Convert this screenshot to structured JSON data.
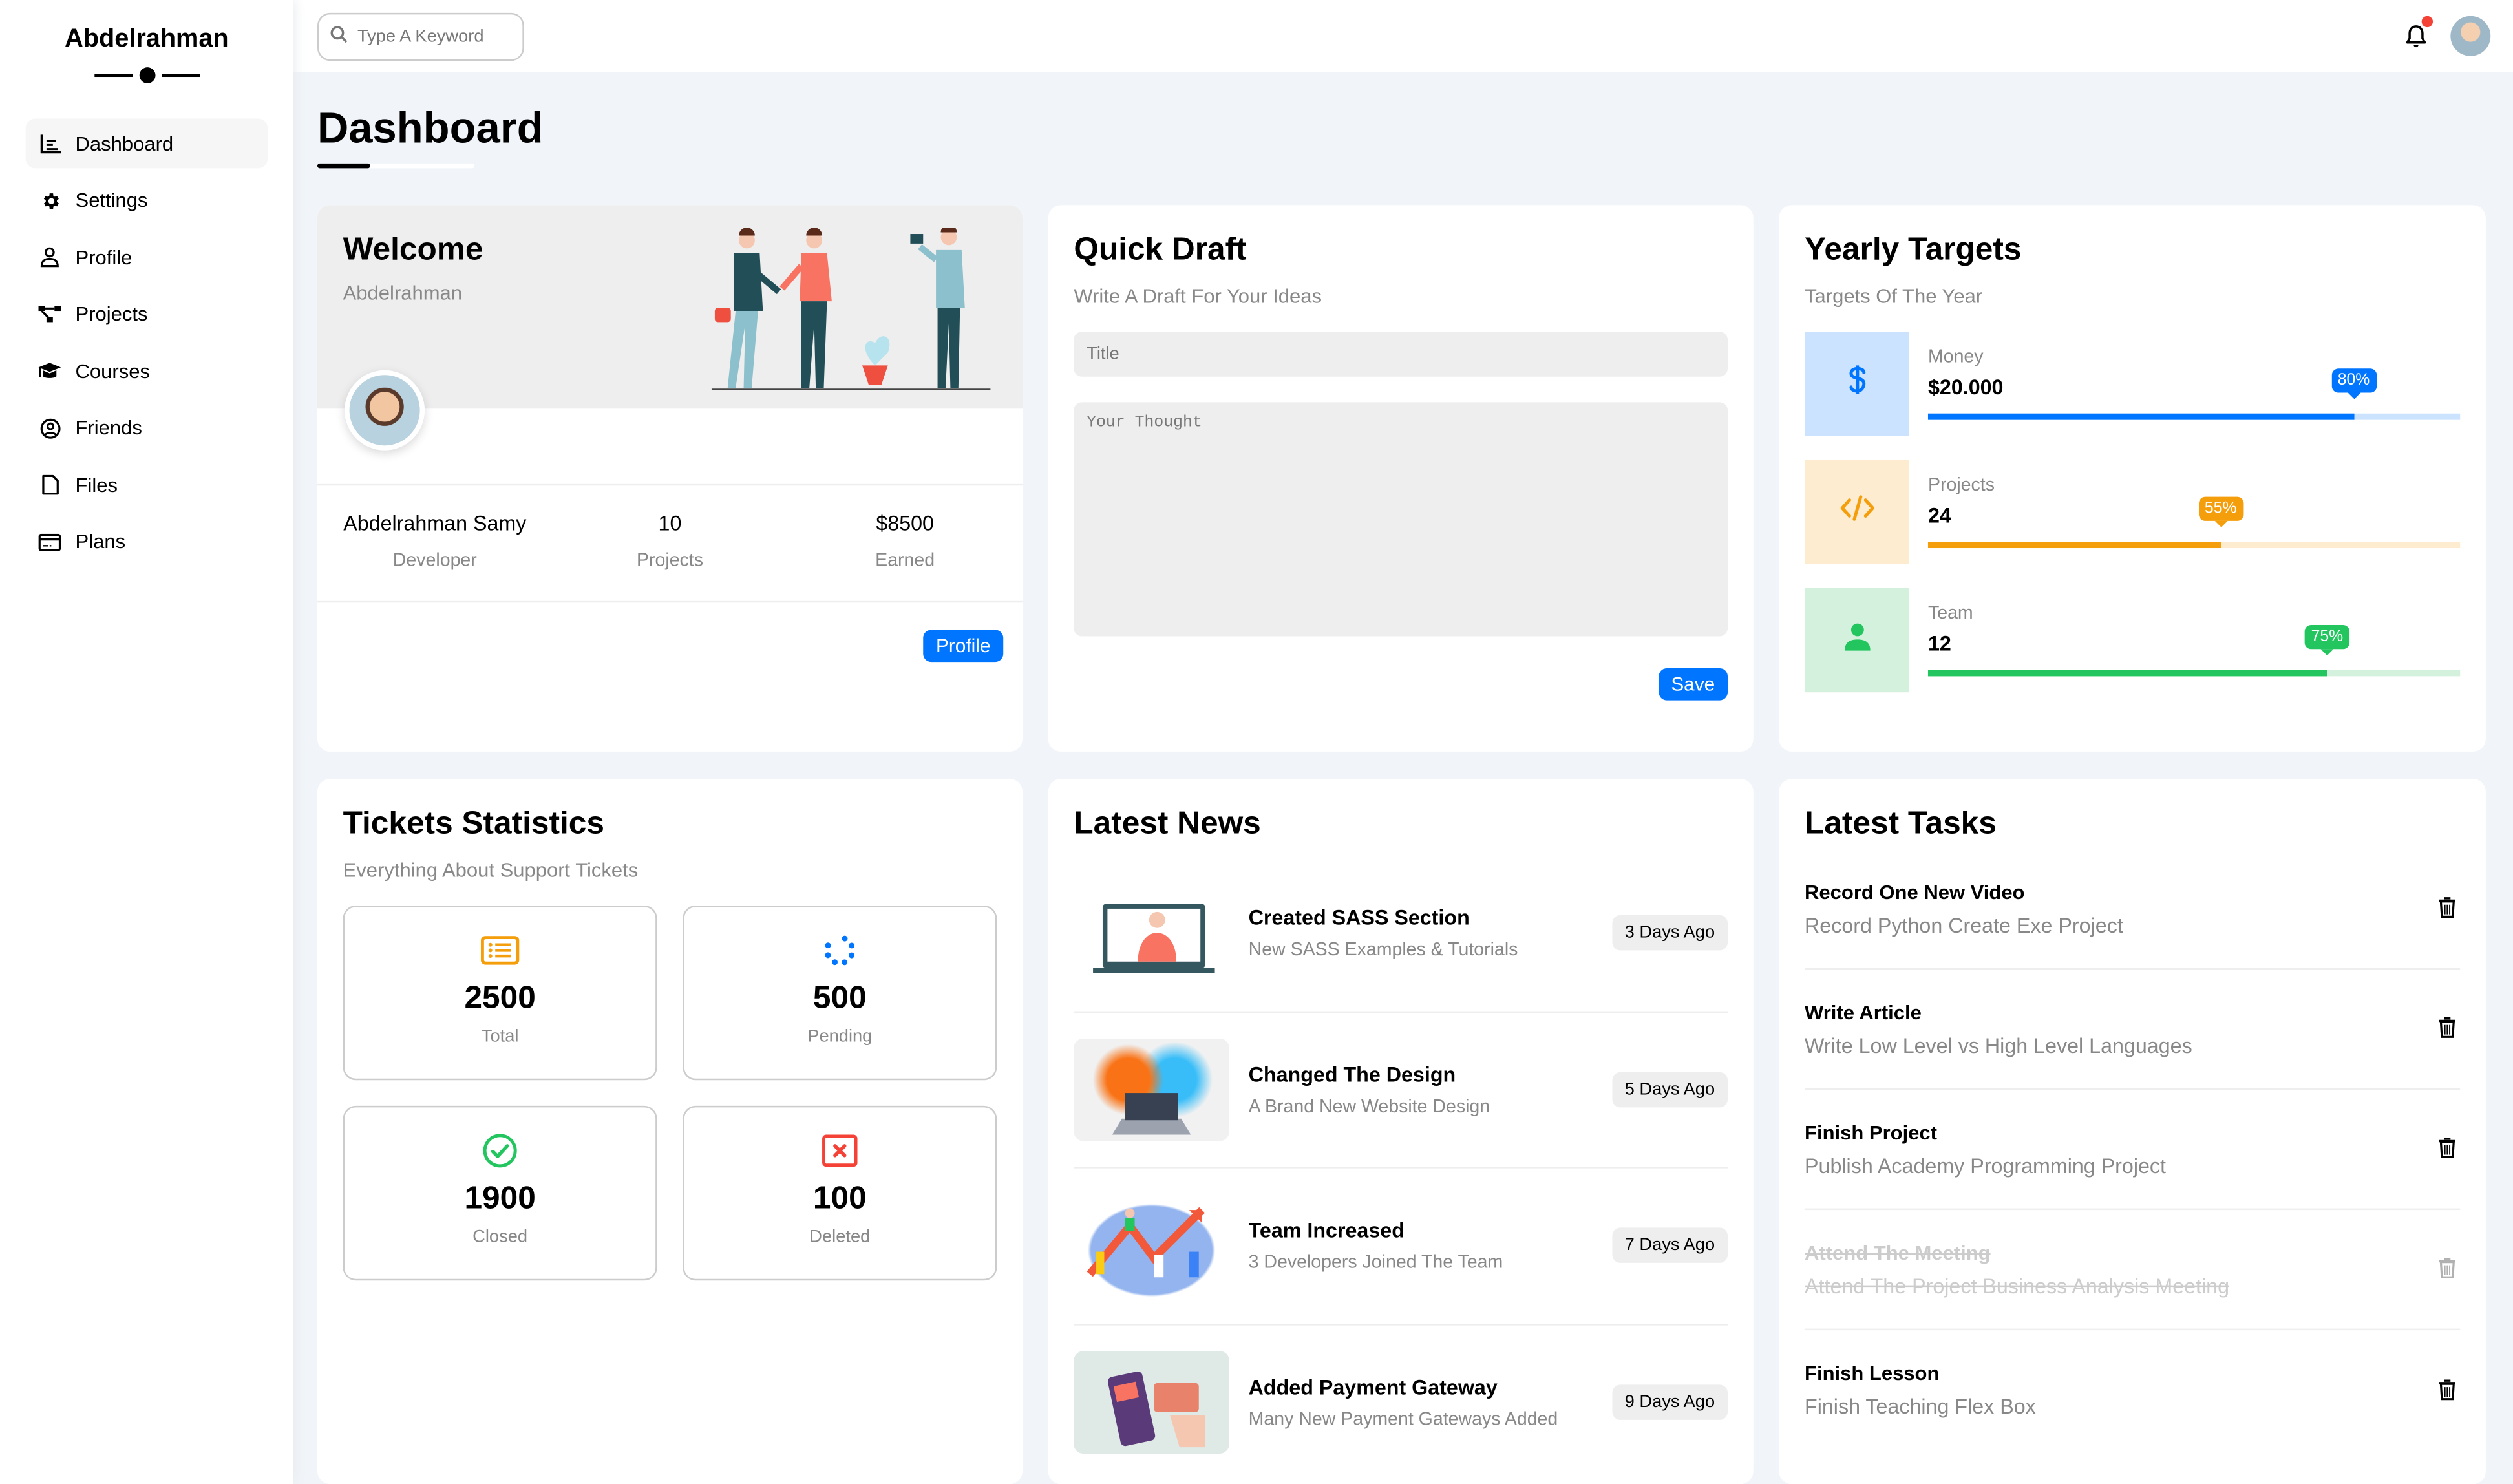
{
  "sidebar": {
    "brand": "Abdelrahman",
    "items": [
      {
        "label": "Dashboard",
        "icon": "chart-icon",
        "active": true
      },
      {
        "label": "Settings",
        "icon": "gear-icon"
      },
      {
        "label": "Profile",
        "icon": "user-icon"
      },
      {
        "label": "Projects",
        "icon": "diagram-icon"
      },
      {
        "label": "Courses",
        "icon": "graduation-cap-icon"
      },
      {
        "label": "Friends",
        "icon": "user-circle-icon"
      },
      {
        "label": "Files",
        "icon": "file-icon"
      },
      {
        "label": "Plans",
        "icon": "credit-card-icon"
      }
    ]
  },
  "topbar": {
    "search_placeholder": "Type A Keyword",
    "notification_dot_color": "#f44336"
  },
  "page": {
    "title": "Dashboard"
  },
  "welcome": {
    "title": "Welcome",
    "subtitle": "Abdelrahman",
    "stats": [
      {
        "value": "Abdelrahman Samy",
        "label": "Developer"
      },
      {
        "value": "10",
        "label": "Projects"
      },
      {
        "value": "$8500",
        "label": "Earned"
      }
    ],
    "button": "Profile"
  },
  "draft": {
    "title": "Quick Draft",
    "subtitle": "Write A Draft For Your Ideas",
    "title_placeholder": "Title",
    "body_placeholder": "Your Thought",
    "button": "Save"
  },
  "targets": {
    "title": "Yearly Targets",
    "subtitle": "Targets Of The Year",
    "items": [
      {
        "label": "Money",
        "value": "$20.000",
        "percent": 80,
        "percent_label": "80%",
        "icon": "dollar-icon",
        "color": "#0075ff",
        "bg": "#cce3ff"
      },
      {
        "label": "Projects",
        "value": "24",
        "percent": 55,
        "percent_label": "55%",
        "icon": "code-icon",
        "color": "#f59e0b",
        "bg": "#fdecd0"
      },
      {
        "label": "Team",
        "value": "12",
        "percent": 75,
        "percent_label": "75%",
        "icon": "user-icon",
        "color": "#22c55e",
        "bg": "#d4f1de"
      }
    ]
  },
  "tickets": {
    "title": "Tickets Statistics",
    "subtitle": "Everything About Support Tickets",
    "items": [
      {
        "value": "2500",
        "label": "Total",
        "icon": "list-icon",
        "color": "#f59e0b"
      },
      {
        "value": "500",
        "label": "Pending",
        "icon": "spinner-icon",
        "color": "#0075ff"
      },
      {
        "value": "1900",
        "label": "Closed",
        "icon": "check-circle-icon",
        "color": "#22c55e"
      },
      {
        "value": "100",
        "label": "Deleted",
        "icon": "x-square-icon",
        "color": "#f44336"
      }
    ]
  },
  "news": {
    "title": "Latest News",
    "items": [
      {
        "title": "Created SASS Section",
        "desc": "New SASS Examples & Tutorials",
        "ago": "3 Days Ago"
      },
      {
        "title": "Changed The Design",
        "desc": "A Brand New Website Design",
        "ago": "5 Days Ago"
      },
      {
        "title": "Team Increased",
        "desc": "3 Developers Joined The Team",
        "ago": "7 Days Ago"
      },
      {
        "title": "Added Payment Gateway",
        "desc": "Many New Payment Gateways Added",
        "ago": "9 Days Ago"
      }
    ]
  },
  "tasks": {
    "title": "Latest Tasks",
    "items": [
      {
        "title": "Record One New Video",
        "desc": "Record Python Create Exe Project",
        "done": false
      },
      {
        "title": "Write Article",
        "desc": "Write Low Level vs High Level Languages",
        "done": false
      },
      {
        "title": "Finish Project",
        "desc": "Publish Academy Programming Project",
        "done": false
      },
      {
        "title": "Attend The Meeting",
        "desc": "Attend The Project Business Analysis Meeting",
        "done": true
      },
      {
        "title": "Finish Lesson",
        "desc": "Finish Teaching Flex Box",
        "done": false
      }
    ]
  }
}
